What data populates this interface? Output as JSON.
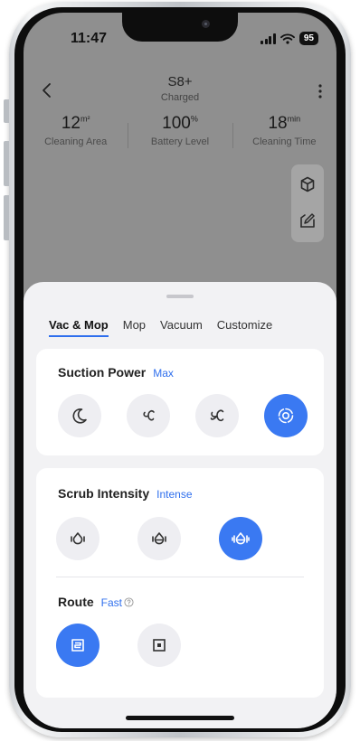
{
  "status_bar": {
    "time": "11:47",
    "battery": "95"
  },
  "header": {
    "device_name": "S8+",
    "device_status": "Charged"
  },
  "stats": [
    {
      "value": "12",
      "unit": "m²",
      "label": "Cleaning Area"
    },
    {
      "value": "100",
      "unit": "%",
      "label": "Battery Level"
    },
    {
      "value": "18",
      "unit": "min",
      "label": "Cleaning Time"
    }
  ],
  "tabs": [
    "Vac & Mop",
    "Mop",
    "Vacuum",
    "Customize"
  ],
  "active_tab": "Vac & Mop",
  "suction": {
    "title": "Suction Power",
    "value": "Max",
    "options": [
      "quiet-mode-icon",
      "balanced-mode-icon",
      "turbo-mode-icon",
      "max-mode-icon"
    ],
    "selected_index": 3
  },
  "scrub": {
    "title": "Scrub Intensity",
    "value": "Intense",
    "options": [
      "scrub-mild-icon",
      "scrub-moderate-icon",
      "scrub-intense-icon"
    ],
    "selected_index": 2
  },
  "route": {
    "title": "Route",
    "value": "Fast",
    "options": [
      "route-fast-icon",
      "route-standard-icon"
    ],
    "selected_index": 0
  },
  "colors": {
    "accent": "#3a79f2",
    "map_bg": "#8f8f8f",
    "sheet_bg": "#f2f2f4"
  }
}
